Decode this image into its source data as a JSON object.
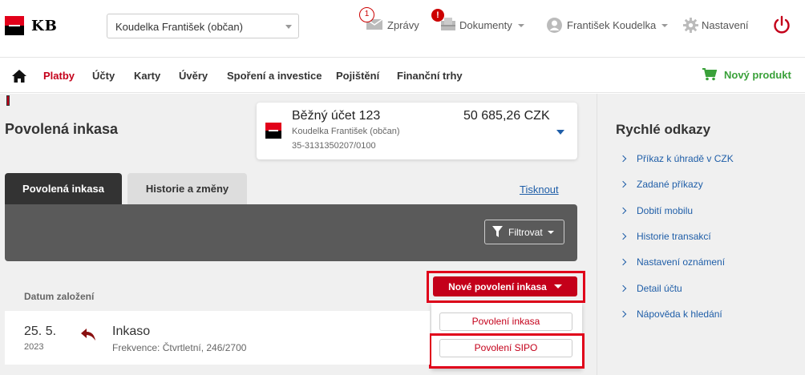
{
  "header": {
    "logo_text": "KB",
    "user_select": "Koudelka František (občan)",
    "messages": {
      "label": "Zprávy",
      "count": "1"
    },
    "documents": {
      "label": "Dokumenty",
      "badge": "!"
    },
    "user_name": "František Koudelka",
    "settings": "Nastavení"
  },
  "nav": {
    "items": [
      "Platby",
      "Účty",
      "Karty",
      "Úvěry",
      "Spoření a investice",
      "Pojištění",
      "Finanční trhy"
    ],
    "active_index": 0,
    "new_product": "Nový produkt"
  },
  "page": {
    "title": "Povolená inkasa"
  },
  "account": {
    "name": "Běžný účet 123",
    "balance": "50 685,26 CZK",
    "owner": "Koudelka František (občan)",
    "number": "35-3131350207/0100"
  },
  "tabs": {
    "active": "Povolená inkasa",
    "inactive": "Historie a změny",
    "print": "Tisknout"
  },
  "filter": {
    "label": "Filtrovat"
  },
  "list": {
    "column_header": "Datum založení",
    "new_button": "Nové povolení inkasa",
    "dropdown": [
      "Povolení inkasa",
      "Povolení SIPO"
    ],
    "rows": [
      {
        "date": "25. 5.",
        "year": "2023",
        "title": "Inkaso",
        "subtitle": "Frekvence: Čtvrtletní, 246/2700"
      }
    ]
  },
  "quick_links": {
    "title": "Rychlé odkazy",
    "items": [
      "Příkaz k úhradě v CZK",
      "Zadané příkazy",
      "Dobití mobilu",
      "Historie transakcí",
      "Nastavení oznámení",
      "Detail účtu",
      "Nápověda k hledání"
    ]
  },
  "colors": {
    "brand_red": "#c4001a",
    "link_blue": "#1f5ea8",
    "success_green": "#3aa13a",
    "highlight": "#e0001a"
  }
}
